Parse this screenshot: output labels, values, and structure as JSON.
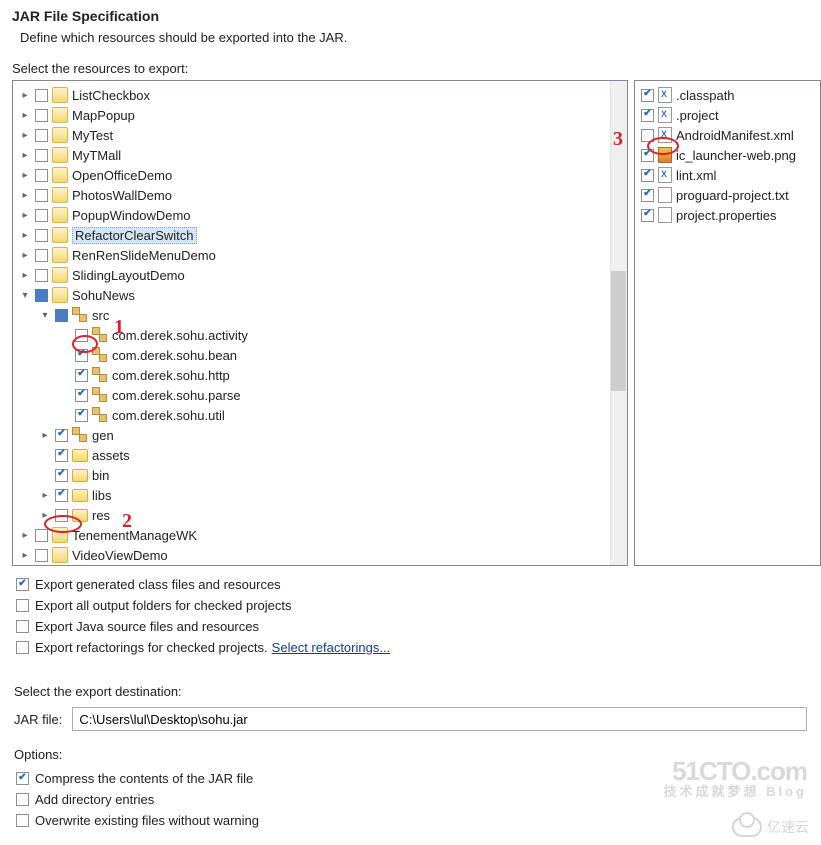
{
  "header": {
    "title": "JAR File Specification",
    "subtitle": "Define which resources should be exported into the JAR."
  },
  "section_label": "Select the resources to export:",
  "tree": {
    "items": [
      {
        "level": 0,
        "exp": "closed",
        "check": "off",
        "icon": "proj",
        "label": "ListCheckbox"
      },
      {
        "level": 0,
        "exp": "closed",
        "check": "off",
        "icon": "proj",
        "label": "MapPopup"
      },
      {
        "level": 0,
        "exp": "closed",
        "check": "off",
        "icon": "proj",
        "label": "MyTest"
      },
      {
        "level": 0,
        "exp": "closed",
        "check": "off",
        "icon": "proj",
        "label": "MyTMall"
      },
      {
        "level": 0,
        "exp": "closed",
        "check": "off",
        "icon": "proj",
        "label": "OpenOfficeDemo"
      },
      {
        "level": 0,
        "exp": "closed",
        "check": "off",
        "icon": "proj",
        "label": "PhotosWallDemo"
      },
      {
        "level": 0,
        "exp": "closed",
        "check": "off",
        "icon": "proj",
        "label": "PopupWindowDemo"
      },
      {
        "level": 0,
        "exp": "closed",
        "check": "off",
        "icon": "proj",
        "label": "RefactorClearSwitch",
        "sel": true
      },
      {
        "level": 0,
        "exp": "closed",
        "check": "off",
        "icon": "proj",
        "label": "RenRenSlideMenuDemo"
      },
      {
        "level": 0,
        "exp": "closed",
        "check": "off",
        "icon": "proj",
        "label": "SlidingLayoutDemo"
      },
      {
        "level": 0,
        "exp": "open",
        "check": "filled",
        "icon": "proj",
        "label": "SohuNews"
      },
      {
        "level": 1,
        "exp": "open",
        "check": "filled",
        "icon": "pkg",
        "label": "src"
      },
      {
        "level": 2,
        "exp": "none",
        "check": "off",
        "icon": "pkg",
        "label": "com.derek.sohu.activity"
      },
      {
        "level": 2,
        "exp": "none",
        "check": "on",
        "icon": "pkg",
        "label": "com.derek.sohu.bean"
      },
      {
        "level": 2,
        "exp": "none",
        "check": "on",
        "icon": "pkg",
        "label": "com.derek.sohu.http"
      },
      {
        "level": 2,
        "exp": "none",
        "check": "on",
        "icon": "pkg",
        "label": "com.derek.sohu.parse"
      },
      {
        "level": 2,
        "exp": "none",
        "check": "on",
        "icon": "pkg",
        "label": "com.derek.sohu.util"
      },
      {
        "level": 1,
        "exp": "closed",
        "check": "on",
        "icon": "pkg",
        "label": "gen"
      },
      {
        "level": 1,
        "exp": "none",
        "check": "on",
        "icon": "folder",
        "label": "assets"
      },
      {
        "level": 1,
        "exp": "none",
        "check": "on",
        "icon": "folder",
        "label": "bin"
      },
      {
        "level": 1,
        "exp": "closed",
        "check": "on",
        "icon": "folder",
        "label": "libs"
      },
      {
        "level": 1,
        "exp": "closed",
        "check": "off",
        "icon": "folder",
        "label": "res"
      },
      {
        "level": 0,
        "exp": "closed",
        "check": "off",
        "icon": "proj",
        "label": "TenementManageWK"
      },
      {
        "level": 0,
        "exp": "closed",
        "check": "off",
        "icon": "proj",
        "label": "VideoViewDemo"
      }
    ]
  },
  "files": [
    {
      "check": "on",
      "icon": "x",
      "label": ".classpath"
    },
    {
      "check": "on",
      "icon": "x",
      "label": ".project"
    },
    {
      "check": "off",
      "icon": "x",
      "label": "AndroidManifest.xml"
    },
    {
      "check": "on",
      "icon": "img",
      "label": "ic_launcher-web.png"
    },
    {
      "check": "on",
      "icon": "x",
      "label": "lint.xml"
    },
    {
      "check": "on",
      "icon": "file",
      "label": "proguard-project.txt"
    },
    {
      "check": "on",
      "icon": "file",
      "label": "project.properties"
    }
  ],
  "export_options": [
    {
      "check": "on",
      "label": "Export generated class files and resources"
    },
    {
      "check": "off",
      "label": "Export all output folders for checked projects"
    },
    {
      "check": "off",
      "label": "Export Java source files and resources"
    },
    {
      "check": "off",
      "label": "Export refactorings for checked projects.",
      "link": "Select refactorings..."
    }
  ],
  "destination": {
    "section": "Select the export destination:",
    "label": "JAR file:",
    "value": "C:\\Users\\lul\\Desktop\\sohu.jar"
  },
  "options2": {
    "section": "Options:",
    "items": [
      {
        "check": "on",
        "label": "Compress the contents of the JAR file"
      },
      {
        "check": "off",
        "label": "Add directory entries"
      },
      {
        "check": "off",
        "label": "Overwrite existing files without warning"
      }
    ]
  },
  "annotations": {
    "a1": "1",
    "a2": "2",
    "a3": "3"
  },
  "watermark": {
    "line1": "51CTO.com",
    "line2": "技术成就梦想  Blog",
    "brand": "亿速云"
  }
}
